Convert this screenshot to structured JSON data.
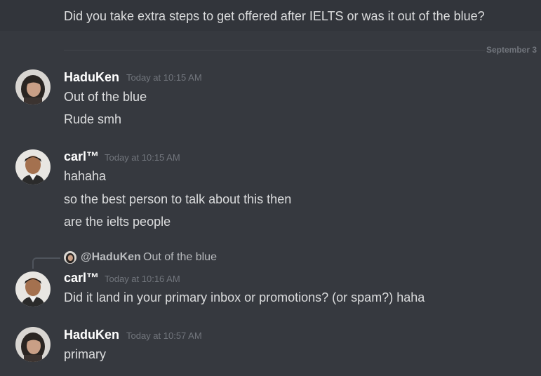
{
  "top_message": {
    "text": "Did you take extra steps to get offered after IELTS or was it out of the blue?"
  },
  "date_divider": {
    "label": "September 3"
  },
  "messages": [
    {
      "username": "HaduKen",
      "timestamp": "Today at 10:15 AM",
      "avatar": "haduken-avatar",
      "lines": [
        "Out of the blue",
        "Rude smh"
      ]
    },
    {
      "username": "carl™",
      "timestamp": "Today at 10:15 AM",
      "avatar": "carl-avatar",
      "lines": [
        "hahaha",
        "so the best person to talk about this then",
        "are the ielts people"
      ]
    },
    {
      "reply": {
        "mention": "@HaduKen",
        "text": "Out of the blue",
        "avatar": "haduken-avatar"
      },
      "username": "carl™",
      "timestamp": "Today at 10:16 AM",
      "avatar": "carl-avatar",
      "lines": [
        "Did it land in your primary inbox or promotions? (or spam?) haha"
      ]
    },
    {
      "username": "HaduKen",
      "timestamp": "Today at 10:57 AM",
      "avatar": "haduken-avatar",
      "lines": [
        "primary"
      ]
    }
  ],
  "colors": {
    "background": "#36393f",
    "text": "#dcddde",
    "username": "#ffffff",
    "timestamp": "#72767d"
  }
}
